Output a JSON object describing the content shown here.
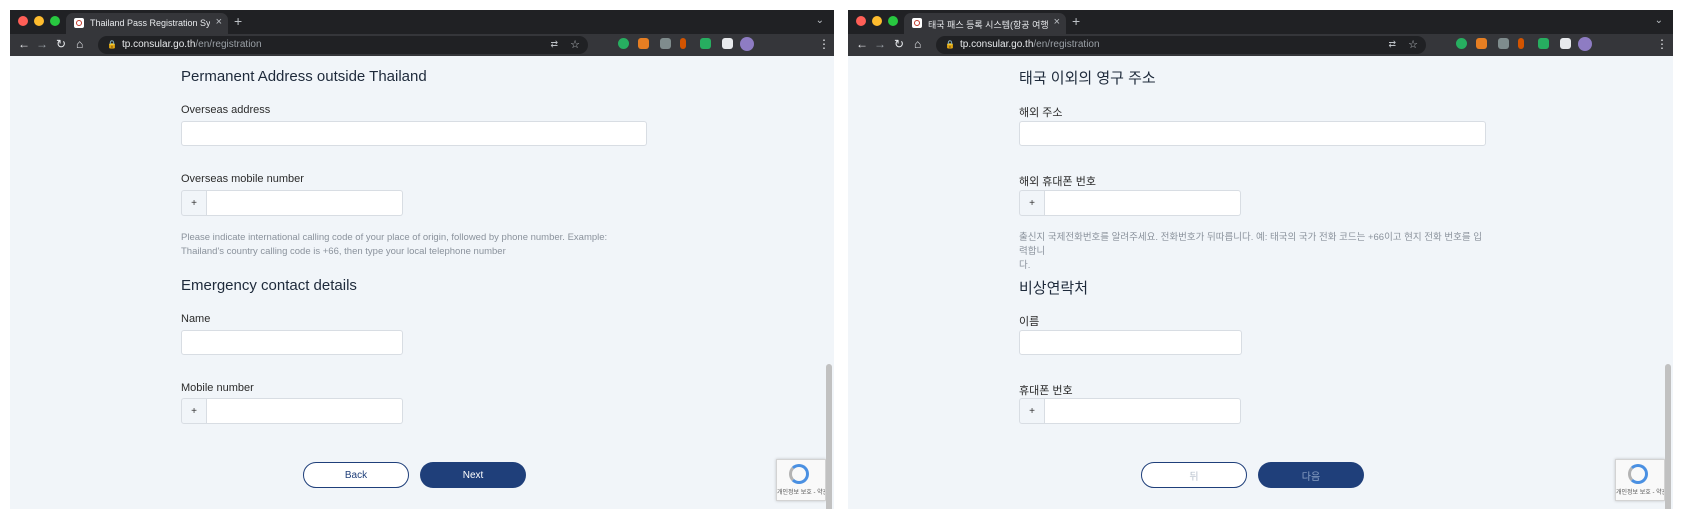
{
  "left": {
    "tab_title": "Thailand Pass Registration Sys",
    "url_host": "tp.consular.go.th",
    "url_path": "/en/registration",
    "section1_title": "Permanent Address outside Thailand",
    "overseas_address_label": "Overseas address",
    "overseas_mobile_label": "Overseas mobile number",
    "phone_prefix": "+",
    "hint_line1": "Please indicate international calling code of your place of origin, followed by phone number. Example:",
    "hint_line2": "Thailand's country calling code is +66, then type your local telephone number",
    "section2_title": "Emergency contact details",
    "name_label": "Name",
    "mobile_label": "Mobile number",
    "back_label": "Back",
    "next_label": "Next",
    "recaptcha_text": "개인정보 보호 - 약관"
  },
  "right": {
    "tab_title": "태국 패스 등록 시스템(항공 여행만 ",
    "url_host": "tp.consular.go.th",
    "url_path": "/en/registration",
    "section1_title": "태국 이외의 영구 주소",
    "overseas_address_label": "해외 주소",
    "overseas_mobile_label": "해외 휴대폰 번호",
    "phone_prefix": "+",
    "hint_line1": "출신지 국제전화번호를 알려주세요. 전화번호가 뒤따릅니다. 예: 태국의 국가 전화 코드는 +66이고 현지 전화 번호를 입력합니",
    "hint_line2": "다.",
    "section2_title": "비상연락처",
    "name_label": "이름",
    "mobile_label": "휴대폰 번호",
    "back_label": "뒤",
    "next_label": "다음",
    "recaptcha_text": "개인정보 보호 - 약관"
  },
  "browser": {
    "close_glyph": "×",
    "newtab_glyph": "+",
    "tabmenu_glyph": "⌄",
    "back_glyph": "←",
    "forward_glyph": "→",
    "reload_glyph": "↻",
    "home_glyph": "⌂",
    "menu_glyph": "⋮",
    "lock_glyph": "🔒",
    "translate_glyph": "⇄",
    "star_glyph": "☆"
  },
  "colors": {
    "primary": "#1f3f7a",
    "page_bg": "#f1f5f9",
    "tabbar_bg": "#202124",
    "toolbar_bg": "#35363a"
  },
  "icons": [
    "favicon-icon",
    "lock-icon",
    "translate-icon",
    "star-icon",
    "extension-icon",
    "puzzle-icon",
    "avatar",
    "kebab-menu-icon",
    "recaptcha-icon"
  ]
}
